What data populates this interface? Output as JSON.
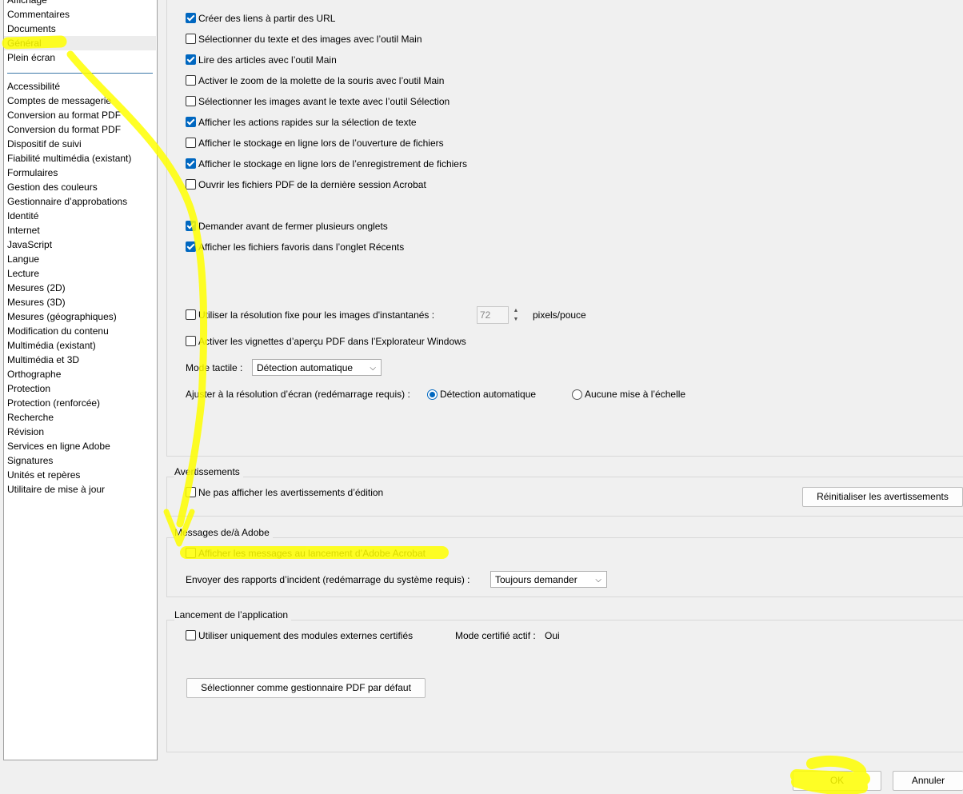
{
  "sidebar": {
    "top_items": [
      {
        "label": "Affichage"
      },
      {
        "label": "Commentaires"
      },
      {
        "label": "Documents"
      },
      {
        "label": "Général"
      },
      {
        "label": "Plein écran"
      }
    ],
    "items": [
      {
        "label": "Accessibilité"
      },
      {
        "label": "Comptes de messagerie"
      },
      {
        "label": "Conversion au format PDF"
      },
      {
        "label": "Conversion du format PDF"
      },
      {
        "label": "Dispositif de suivi"
      },
      {
        "label": "Fiabilité multimédia (existant)"
      },
      {
        "label": "Formulaires"
      },
      {
        "label": "Gestion des couleurs"
      },
      {
        "label": "Gestionnaire d’approbations"
      },
      {
        "label": "Identité"
      },
      {
        "label": "Internet"
      },
      {
        "label": "JavaScript"
      },
      {
        "label": "Langue"
      },
      {
        "label": "Lecture"
      },
      {
        "label": "Mesures (2D)"
      },
      {
        "label": "Mesures (3D)"
      },
      {
        "label": "Mesures (géographiques)"
      },
      {
        "label": "Modification du contenu"
      },
      {
        "label": "Multimédia (existant)"
      },
      {
        "label": "Multimédia et 3D"
      },
      {
        "label": "Orthographe"
      },
      {
        "label": "Protection"
      },
      {
        "label": "Protection (renforcée)"
      },
      {
        "label": "Recherche"
      },
      {
        "label": "Révision"
      },
      {
        "label": "Services en ligne Adobe"
      },
      {
        "label": "Signatures"
      },
      {
        "label": "Unités et repères"
      },
      {
        "label": "Utilitaire de mise à jour"
      }
    ]
  },
  "options": [
    {
      "label": "Créer des liens à partir des URL",
      "checked": true
    },
    {
      "label": "Sélectionner du texte et des images avec l’outil Main",
      "checked": false
    },
    {
      "label": "Lire des articles avec l’outil Main",
      "checked": true
    },
    {
      "label": "Activer le zoom de la molette de la souris avec l’outil Main",
      "checked": false
    },
    {
      "label": "Sélectionner les images avant le texte avec l’outil Sélection",
      "checked": false
    },
    {
      "label": "Afficher les actions rapides sur la sélection de texte",
      "checked": true
    },
    {
      "label": "Afficher le stockage en ligne lors de l’ouverture de fichiers",
      "checked": false
    },
    {
      "label": "Afficher le stockage en ligne lors de l’enregistrement de fichiers",
      "checked": true
    },
    {
      "label": "Ouvrir les fichiers PDF de la dernière session Acrobat",
      "checked": false
    },
    {
      "label": "Demander avant de fermer plusieurs onglets",
      "checked": true
    },
    {
      "label": "Afficher les fichiers favoris dans l’onglet Récents",
      "checked": true
    }
  ],
  "resolution": {
    "label": "Utiliser la résolution fixe pour les images d'instantanés :",
    "value": "72",
    "unit": "pixels/pouce"
  },
  "thumbnails": {
    "label": "Activer les vignettes d’aperçu PDF dans l’Explorateur Windows"
  },
  "touch_mode": {
    "label": "Mode tactile :",
    "value": "Détection automatique"
  },
  "scaling": {
    "label": "Ajuster à la résolution d’écran (redémarrage requis) :",
    "option_auto": "Détection automatique",
    "option_none": "Aucune mise à l’échelle"
  },
  "warnings": {
    "title": "Avertissements",
    "checkbox_label": "Ne pas afficher les avertissements d’édition",
    "reset_button": "Réinitialiser les avertissements"
  },
  "messages": {
    "title": "Messages de/à Adobe",
    "checkbox_label": "Afficher les messages au lancement d’Adobe Acrobat",
    "crash_label": "Envoyer des rapports d’incident (redémarrage du système requis) :",
    "crash_value": "Toujours demander"
  },
  "launch": {
    "title": "Lancement de l’application",
    "checkbox_label": "Utiliser uniquement des modules externes certifiés",
    "cert_mode_label": "Mode certifié actif :",
    "cert_mode_value": "Oui",
    "default_button": "Sélectionner comme gestionnaire PDF par défaut"
  },
  "footer": {
    "ok": "OK",
    "cancel": "Annuler"
  },
  "colors": {
    "accent": "#0067c0",
    "highlighter": "#ffff00"
  },
  "icons": {
    "check": "check-icon",
    "chevron": "chevron-down-icon"
  }
}
